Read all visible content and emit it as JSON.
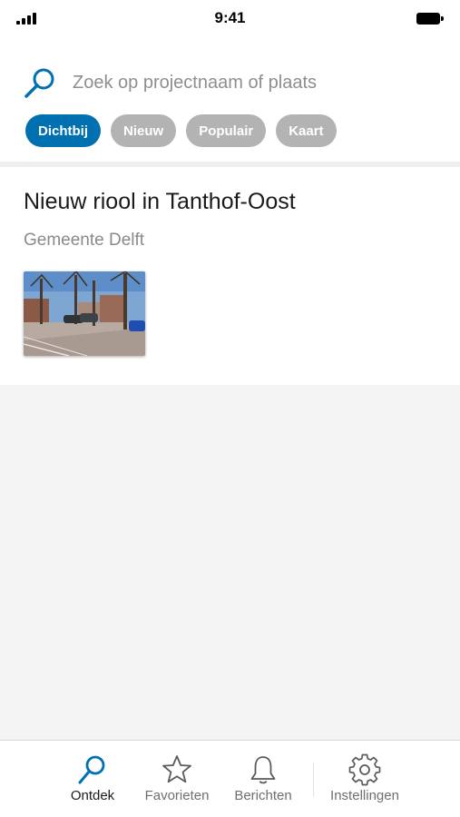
{
  "status_bar": {
    "time": "9:41"
  },
  "search": {
    "placeholder": "Zoek op projectnaam of plaats"
  },
  "filters": [
    {
      "label": "Dichtbij",
      "active": true
    },
    {
      "label": "Nieuw",
      "active": false
    },
    {
      "label": "Populair",
      "active": false
    },
    {
      "label": "Kaart",
      "active": false
    }
  ],
  "project_card": {
    "title": "Nieuw riool in Tanthof-Oost",
    "subtitle": "Gemeente Delft",
    "image_icon": "street-photo"
  },
  "tab_bar": [
    {
      "label": "Ontdek",
      "icon": "search-icon",
      "active": true
    },
    {
      "label": "Favorieten",
      "icon": "star-icon",
      "active": false
    },
    {
      "label": "Berichten",
      "icon": "bell-icon",
      "active": false
    },
    {
      "label": "Instellingen",
      "icon": "gear-icon",
      "active": false
    }
  ],
  "colors": {
    "accent": "#0070b1",
    "chip_inactive": "#b3b3b3",
    "background": "#f4f4f4"
  }
}
